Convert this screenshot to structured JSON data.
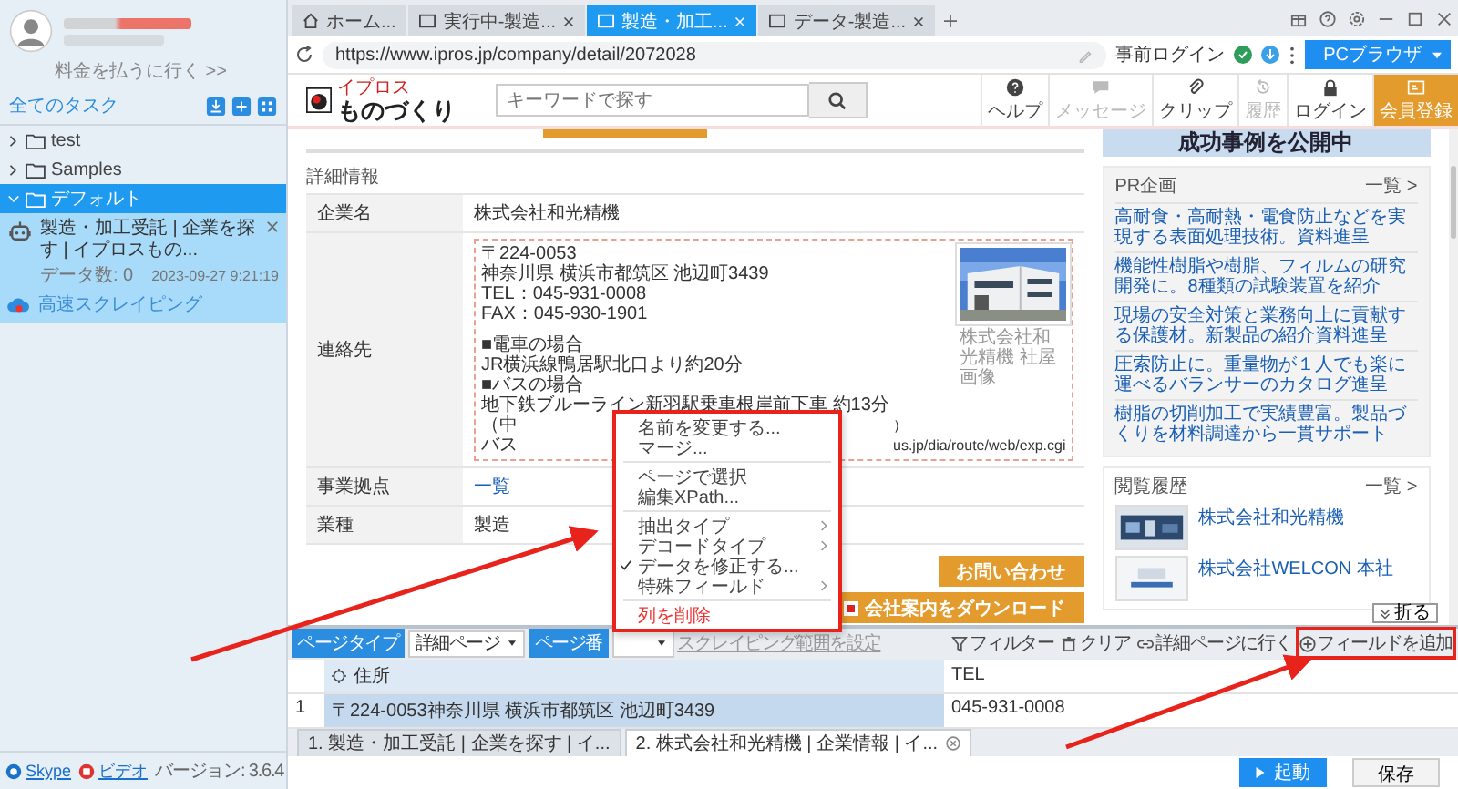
{
  "sidebar": {
    "pay_link": "料金を払うに行く >>",
    "section_title": "全てのタスク",
    "tree": [
      {
        "label": "test",
        "expanded": false,
        "selected": false
      },
      {
        "label": "Samples",
        "expanded": false,
        "selected": false
      },
      {
        "label": "デフォルト",
        "expanded": true,
        "selected": true,
        "tasks": [
          {
            "title": "製造・加工受託 | 企業を探す | イプロスもの...",
            "count": "データ数: 0",
            "time": "2023-09-27 9:21:19",
            "mode": "高速スクレイピング"
          }
        ]
      }
    ],
    "footer_links": [
      "Skype",
      "ビデオ"
    ],
    "version": "バージョン: 3.6.4"
  },
  "browser": {
    "tabs": [
      {
        "label": "ホーム...",
        "kind": "home",
        "selected": false,
        "closable": false
      },
      {
        "label": "実行中-製造...",
        "kind": "page",
        "selected": false,
        "closable": true
      },
      {
        "label": "製造・加工...",
        "kind": "page",
        "selected": true,
        "closable": true
      },
      {
        "label": "データ-製造...",
        "kind": "page",
        "selected": false,
        "closable": true
      }
    ],
    "url": "https://www.ipros.jp/company/detail/2072028",
    "login": "事前ログイン",
    "mode_button": "PCブラウザ"
  },
  "site": {
    "logo_small": "イプロス",
    "logo": "ものづくり",
    "search_placeholder": "キーワードで探す",
    "nav": [
      {
        "label": "ヘルプ",
        "disabled": false,
        "highlight": false
      },
      {
        "label": "メッセージ",
        "disabled": true,
        "highlight": false
      },
      {
        "label": "クリップ",
        "disabled": false,
        "highlight": false
      },
      {
        "label": "履歴",
        "disabled": true,
        "highlight": false
      },
      {
        "label": "ログイン",
        "disabled": false,
        "highlight": false
      },
      {
        "label": "会員登録",
        "disabled": false,
        "highlight": true
      }
    ],
    "section": "詳細情報",
    "details": [
      {
        "kind": "text",
        "label": "企業名",
        "value": "株式会社和光精機"
      },
      {
        "kind": "contact",
        "label": "連絡先",
        "address_lines": [
          "〒224-0053",
          "神奈川県 横浜市都筑区 池辺町3439",
          "TEL：045-931-0008",
          "FAX：045-930-1901"
        ],
        "access_lines": [
          "■電車の場合",
          "JR横浜線鴨居駅北口より約20分",
          "■バスの場合",
          "地下鉄ブルーライン新羽駅乗車根岸前下車 約13分"
        ],
        "covered_lines": [
          {
            "left": "（中",
            "right": "）"
          },
          {
            "left": "バス",
            "right": "us.jp/dia/route/web/exp.cgi"
          }
        ],
        "photo_caption": "株式会社和光精機 社屋画像"
      },
      {
        "kind": "link",
        "label": "事業拠点",
        "value": "一覧"
      },
      {
        "kind": "text",
        "label": "業種",
        "value": "製造"
      }
    ],
    "buttons": [
      "お問い合わせ",
      "会社案内をダウンロード"
    ],
    "banner": "成功事例を公開中",
    "pr": {
      "title": "PR企画",
      "more": "一覧 >",
      "links": [
        "高耐食・高耐熱・電食防止などを実現する表面処理技術。資料進呈",
        "機能性樹脂や樹脂、フィルムの研究開発に。8種類の試験装置を紹介",
        "現場の安全対策と業務向上に貢献する保護材。新製品の紹介資料進呈",
        "圧索防止に。重量物が１人でも楽に運べるバランサーのカタログ進呈",
        "樹脂の切削加工で実績豊富。製品づくりを材料調達から一貫サポート"
      ]
    },
    "history": {
      "title": "閲覧履歴",
      "more": "一覧 >",
      "items": [
        "株式会社和光精機",
        "株式会社WELCON 本社"
      ]
    }
  },
  "context_menu": [
    {
      "kind": "item",
      "label": "名前を変更する...",
      "checked": false
    },
    {
      "kind": "item",
      "label": "マージ...",
      "checked": false
    },
    {
      "kind": "divider"
    },
    {
      "kind": "item",
      "label": "ページで選択",
      "checked": false
    },
    {
      "kind": "item",
      "label": "編集XPath...",
      "checked": false
    },
    {
      "kind": "divider"
    },
    {
      "kind": "submenu",
      "label": "抽出タイプ",
      "checked": false
    },
    {
      "kind": "submenu",
      "label": "デコードタイプ",
      "checked": false
    },
    {
      "kind": "item",
      "label": "データを修正する...",
      "checked": true
    },
    {
      "kind": "submenu",
      "label": "特殊フィールド",
      "checked": false
    },
    {
      "kind": "divider"
    },
    {
      "kind": "danger",
      "label": "列を削除",
      "checked": false
    }
  ],
  "panel": {
    "page_type_label": "ページタイプ",
    "page_type": "詳細ページ",
    "page_no_label": "ページ番",
    "range_link": "スクレイピング範囲を設定",
    "actions": [
      "フィルター",
      "クリア",
      "詳細ページに行く",
      "フィールドを追加"
    ],
    "collapse": "折る",
    "columns": [
      {
        "label": "住所",
        "selected": true
      },
      {
        "label": "TEL",
        "selected": false
      }
    ],
    "rows": [
      {
        "index": "1",
        "cells": [
          "〒224-0053神奈川県 横浜市都筑区 池辺町3439",
          "045-931-0008"
        ]
      }
    ]
  },
  "task_tabs": [
    {
      "label": "1. 製造・加工受託 | 企業を探す | イ...",
      "selected": false,
      "closable": false
    },
    {
      "label": "2. 株式会社和光精機 | 企業情報 | イ...",
      "selected": true,
      "closable": true
    }
  ],
  "run_button": "起動",
  "save_button": "保存"
}
